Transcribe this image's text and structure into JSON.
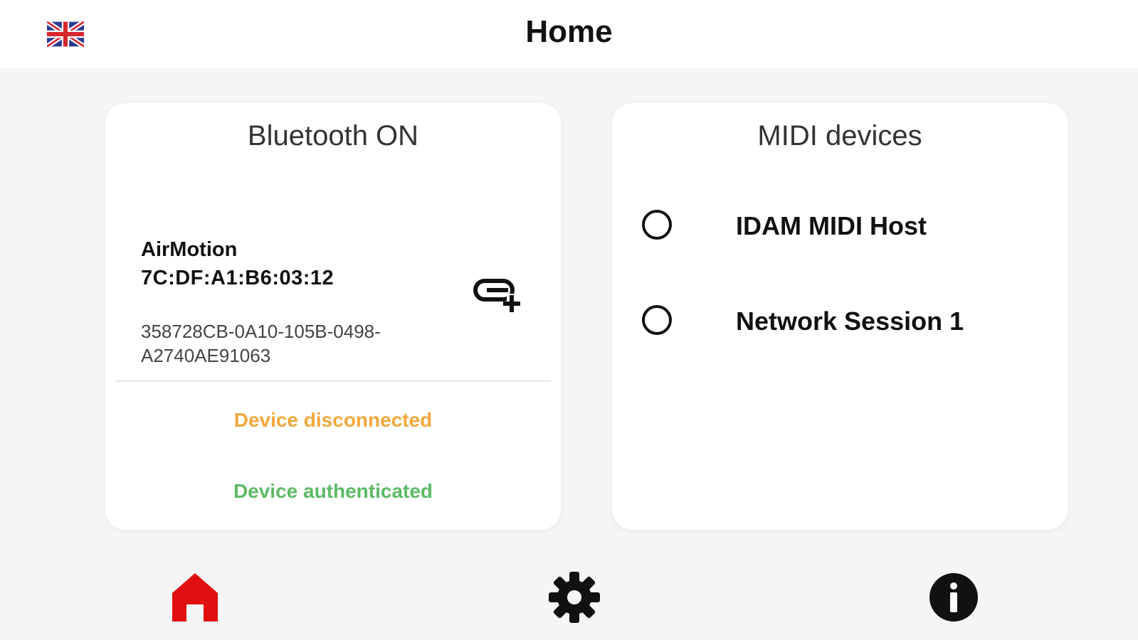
{
  "header": {
    "title": "Home",
    "language_icon": "uk-flag-icon"
  },
  "bluetooth_card": {
    "title": "Bluetooth ON",
    "device": {
      "name": "AirMotion",
      "mac": "7C:DF:A1:B6:03:12",
      "uuid": "358728CB-0A10-105B-0498-A2740AE91063",
      "action_icon": "link-add-icon"
    },
    "status_disconnected": "Device disconnected",
    "status_authenticated": "Device authenticated"
  },
  "midi_card": {
    "title": "MIDI devices",
    "items": [
      {
        "label": "IDAM MIDI Host",
        "selected": false
      },
      {
        "label": "Network Session 1",
        "selected": false
      }
    ]
  },
  "bottom_nav": {
    "items": [
      {
        "icon": "home-icon",
        "active": true
      },
      {
        "icon": "gear-icon",
        "active": false
      },
      {
        "icon": "info-icon",
        "active": false
      }
    ]
  },
  "colors": {
    "accent": "#e01010",
    "disconnected": "#f3a73a",
    "authenticated": "#5cba66",
    "background": "#f5f5f5"
  }
}
